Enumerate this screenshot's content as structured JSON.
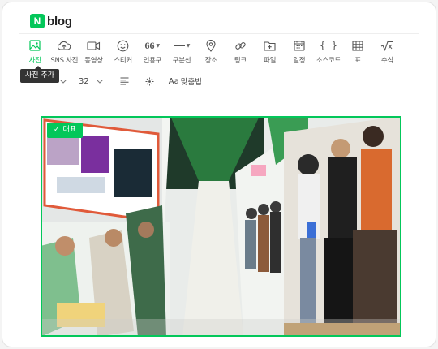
{
  "app": {
    "logo_letter": "N",
    "logo_text": "blog"
  },
  "toolbar": {
    "items": [
      {
        "id": "photo",
        "label": "사진",
        "icon": "photo-icon",
        "active": true
      },
      {
        "id": "sns-photo",
        "label": "SNS 사진",
        "icon": "cloud-upload-icon"
      },
      {
        "id": "video",
        "label": "동영상",
        "icon": "video-icon"
      },
      {
        "id": "sticker",
        "label": "스티커",
        "icon": "smiley-icon"
      },
      {
        "id": "quote",
        "label": "인용구",
        "icon": "quote-icon",
        "glyph": "66"
      },
      {
        "id": "divider",
        "label": "구분선",
        "icon": "horizontal-line-icon"
      },
      {
        "id": "place",
        "label": "장소",
        "icon": "map-pin-icon"
      },
      {
        "id": "link",
        "label": "링크",
        "icon": "link-icon"
      },
      {
        "id": "file",
        "label": "파일",
        "icon": "folder-plus-icon"
      },
      {
        "id": "schedule",
        "label": "일정",
        "icon": "calendar-icon"
      },
      {
        "id": "source-code",
        "label": "소스코드",
        "icon": "braces-icon",
        "glyph": "{ }"
      },
      {
        "id": "table",
        "label": "표",
        "icon": "table-grid-icon"
      },
      {
        "id": "formula",
        "label": "수식",
        "icon": "square-root-icon"
      }
    ]
  },
  "tooltip": {
    "text": "사진 추가"
  },
  "format": {
    "font_size": "32",
    "line_spacing_label": "맞춤법",
    "spell_glyph": "Aa"
  },
  "photo": {
    "badge_label": "대표",
    "badge_check": "✓",
    "accent": "#03c75a"
  }
}
